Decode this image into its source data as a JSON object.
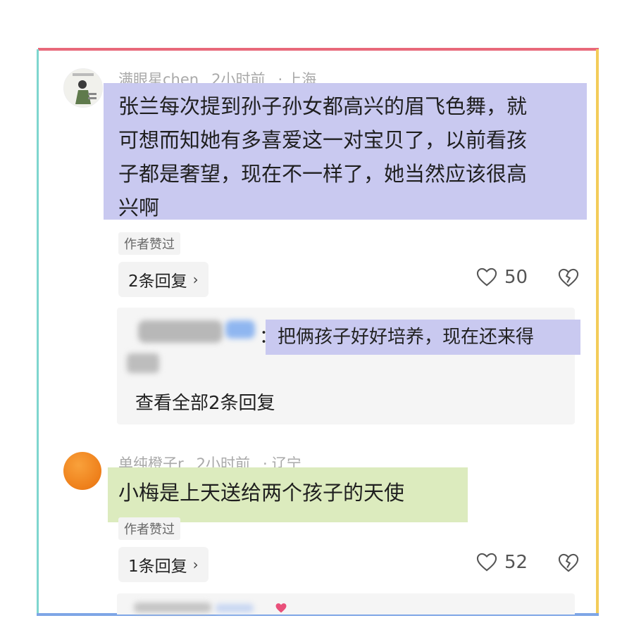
{
  "comments": [
    {
      "username": "满眼星chen",
      "time": "2小时前",
      "location": "上海",
      "text_lines": [
        "张兰每次提到孙子孙女都高兴的眉飞色舞，就",
        "可想而知她有多喜爱这一对宝贝了，以前看孩",
        "子都是奢望，现在不一样了，她当然应该很高",
        "兴啊"
      ],
      "author_tag": "作者赞过",
      "reply_label": "2条回复",
      "likes": "50",
      "reply_preview": {
        "text": "：把俩孩子好好培养，现在还来得",
        "view_all": "查看全部2条回复"
      }
    },
    {
      "username": "单纯橙子r",
      "time": "2小时前",
      "location": "辽宁",
      "text": "小梅是上天送给两个孩子的天使",
      "author_tag": "作者赞过",
      "reply_label": "1条回复",
      "likes": "52"
    }
  ],
  "colors": {
    "frame_top": "#e8697a",
    "frame_left": "#7fd6cf",
    "frame_right": "#f3cc5a",
    "frame_bottom": "#7ea6e6",
    "highlight_purple": "#c9c9f0",
    "highlight_green": "#dcebbe"
  },
  "icons": [
    "heart-outline-icon",
    "broken-heart-icon",
    "chevron-right-icon"
  ]
}
